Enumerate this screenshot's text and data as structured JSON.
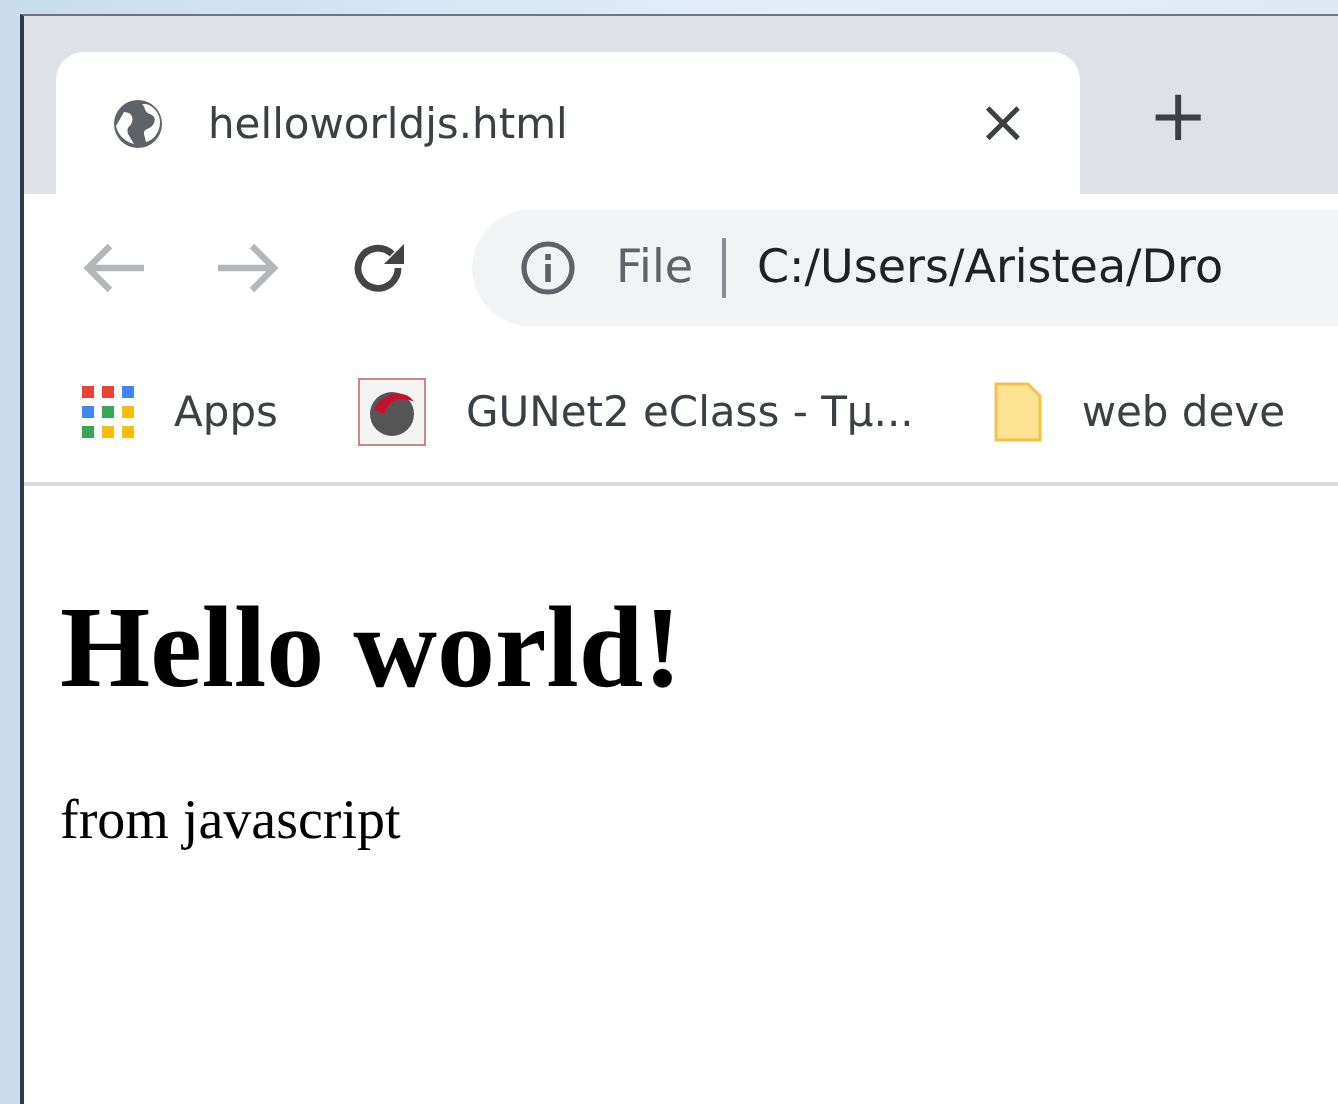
{
  "window": {
    "tab": {
      "title": "helloworldjs.html",
      "selected": true
    },
    "close": "×",
    "new_tab": "+"
  },
  "toolbar": {
    "security": "File",
    "address": "C:/Users/Aristea/Dro"
  },
  "bookmarks": [
    {
      "label": "Apps",
      "kind": "apps"
    },
    {
      "label": "GUNet2 eClass - Τμ...",
      "kind": "site"
    },
    {
      "label": "web deve",
      "kind": "folder"
    }
  ],
  "page": {
    "heading": "Hello world!",
    "paragraph": "from javascript"
  }
}
